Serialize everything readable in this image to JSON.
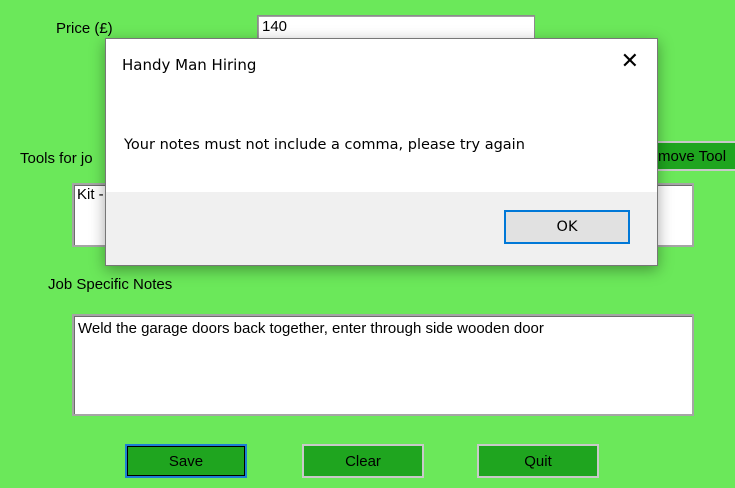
{
  "form": {
    "price_label": "Price (£)",
    "price_value": "140",
    "tools_label": "Tools for jo",
    "remove_tool_label": "move Tool",
    "tools_list_visible": "Kit -",
    "notes_label": "Job Specific Notes",
    "notes_value": "Weld the garage doors back together, enter through side wooden door"
  },
  "buttons": {
    "save": "Save",
    "clear": "Clear",
    "quit": "Quit"
  },
  "dialog": {
    "title": "Handy Man Hiring",
    "close_glyph": "✕",
    "message": "Your notes must not include a comma, please try again",
    "ok": "OK"
  },
  "colors": {
    "background": "#6be85a",
    "button_green": "#1fa51f",
    "focus_blue": "#0078d7"
  }
}
